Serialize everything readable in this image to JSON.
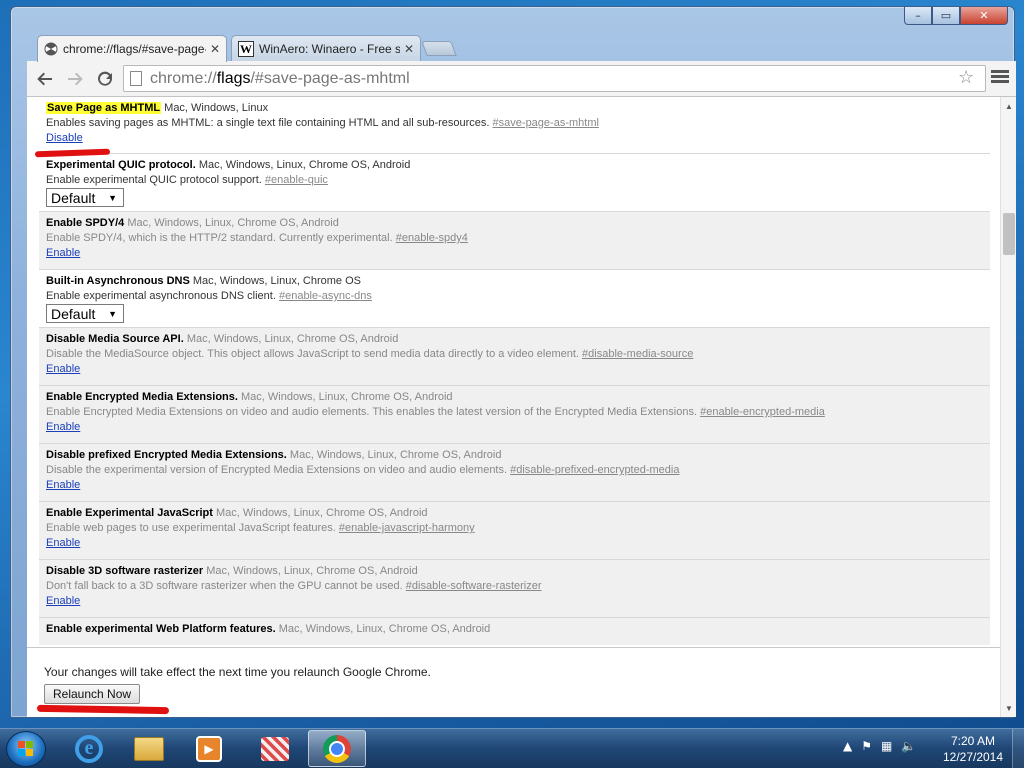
{
  "window": {
    "controls": {
      "minimize": "–",
      "maximize": "▭",
      "close": "✕"
    }
  },
  "tabs": [
    {
      "title": "chrome://flags/#save-page-as-mhtml",
      "active": true,
      "icon": "flags-icon"
    },
    {
      "title": "WinAero: Winaero - Free s",
      "active": false,
      "icon": "winaero-icon",
      "favicon_letter": "W"
    }
  ],
  "toolbar": {
    "back": "🡐",
    "forward": "🡒",
    "reload": "↻",
    "url_scheme": "chrome://",
    "url_host": "flags",
    "url_path": "/#save-page-as-mhtml",
    "star": "☆"
  },
  "flags": [
    {
      "name": "Save Page as MHTML",
      "platforms": "Mac, Windows, Linux",
      "desc": "Enables saving pages as MHTML: a single text file containing HTML and all sub-resources.",
      "anchor": "#save-page-as-mhtml",
      "action": "Disable",
      "highlighted": true
    },
    {
      "name": "Experimental QUIC protocol.",
      "platforms": "Mac, Windows, Linux, Chrome OS, Android",
      "desc": "Enable experimental QUIC protocol support.",
      "anchor": "#enable-quic",
      "select": "Default"
    },
    {
      "name": "Enable SPDY/4",
      "platforms": "Mac, Windows, Linux, Chrome OS, Android",
      "desc": "Enable SPDY/4, which is the HTTP/2 standard. Currently experimental.",
      "anchor": "#enable-spdy4",
      "action": "Enable"
    },
    {
      "name": "Built-in Asynchronous DNS",
      "platforms": "Mac, Windows, Linux, Chrome OS",
      "desc": "Enable experimental asynchronous DNS client.",
      "anchor": "#enable-async-dns",
      "select": "Default"
    },
    {
      "name": "Disable Media Source API.",
      "platforms": "Mac, Windows, Linux, Chrome OS, Android",
      "desc": "Disable the MediaSource object. This object allows JavaScript to send media data directly to a video element.",
      "anchor": "#disable-media-source",
      "action": "Enable"
    },
    {
      "name": "Enable Encrypted Media Extensions.",
      "platforms": "Mac, Windows, Linux, Chrome OS, Android",
      "desc": "Enable Encrypted Media Extensions on video and audio elements. This enables the latest version of the Encrypted Media Extensions.",
      "anchor": "#enable-encrypted-media",
      "action": "Enable"
    },
    {
      "name": "Disable prefixed Encrypted Media Extensions.",
      "platforms": "Mac, Windows, Linux, Chrome OS, Android",
      "desc": "Disable the experimental version of Encrypted Media Extensions on video and audio elements.",
      "anchor": "#disable-prefixed-encrypted-media",
      "action": "Enable"
    },
    {
      "name": "Enable Experimental JavaScript",
      "platforms": "Mac, Windows, Linux, Chrome OS, Android",
      "desc": "Enable web pages to use experimental JavaScript features.",
      "anchor": "#enable-javascript-harmony",
      "action": "Enable"
    },
    {
      "name": "Disable 3D software rasterizer",
      "platforms": "Mac, Windows, Linux, Chrome OS, Android",
      "desc": "Don't fall back to a 3D software rasterizer when the GPU cannot be used.",
      "anchor": "#disable-software-rasterizer",
      "action": "Enable"
    },
    {
      "name": "Enable experimental Web Platform features.",
      "platforms": "Mac, Windows, Linux, Chrome OS, Android",
      "desc": "",
      "anchor": "",
      "action": ""
    }
  ],
  "footer": {
    "message": "Your changes will take effect the next time you relaunch Google Chrome.",
    "relaunch": "Relaunch Now"
  },
  "taskbar": {
    "items": [
      "start-orb",
      "internet-explorer-icon",
      "windows-explorer-icon",
      "windows-media-player-icon",
      "paint-icon",
      "google-chrome-icon"
    ],
    "time": "7:20 AM",
    "date": "12/27/2014"
  },
  "colors": {
    "highlight": "#ffff33",
    "link": "#1a3fb8",
    "annotation_red": "#e01010"
  }
}
